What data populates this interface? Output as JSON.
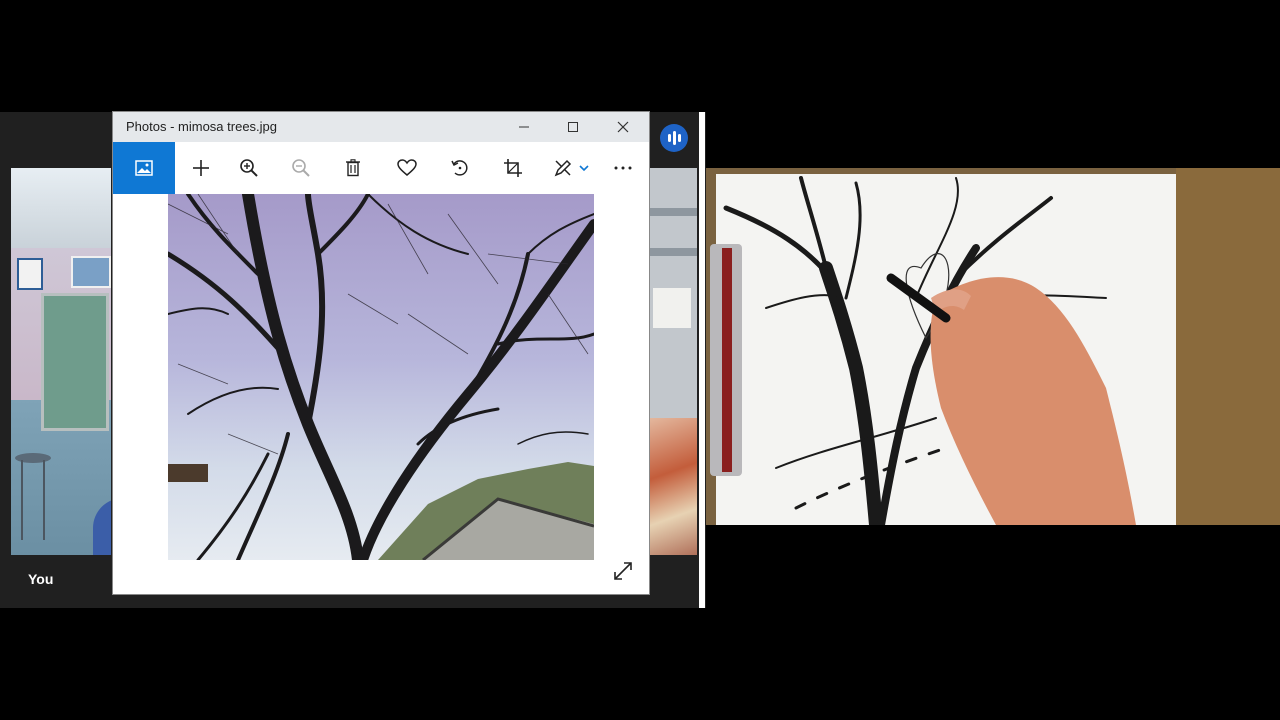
{
  "call": {
    "self_label": "You",
    "colors": {
      "background": "#202020",
      "audio_indicator": "#1e63c6"
    }
  },
  "photos_window": {
    "title": "Photos - mimosa trees.jpg",
    "controls": {
      "minimize_icon": "minimize-icon",
      "maximize_icon": "maximize-icon",
      "close_icon": "close-icon"
    },
    "toolbar": {
      "accent": "#0f78d4",
      "buttons": [
        {
          "name": "view-image",
          "icon": "image-icon",
          "active": true
        },
        {
          "name": "add",
          "icon": "plus-icon"
        },
        {
          "name": "zoom-in",
          "icon": "zoom-in-icon"
        },
        {
          "name": "zoom-out",
          "icon": "zoom-out-icon",
          "disabled": true
        },
        {
          "name": "delete",
          "icon": "trash-icon"
        },
        {
          "name": "favorite",
          "icon": "heart-icon"
        },
        {
          "name": "rotate",
          "icon": "rotate-icon"
        },
        {
          "name": "crop",
          "icon": "crop-icon"
        },
        {
          "name": "edit-create",
          "icon": "pen-icon",
          "has_dropdown": true
        },
        {
          "name": "more",
          "icon": "more-icon"
        }
      ]
    },
    "image": {
      "subject": "tree branches silhouette against sky"
    }
  }
}
